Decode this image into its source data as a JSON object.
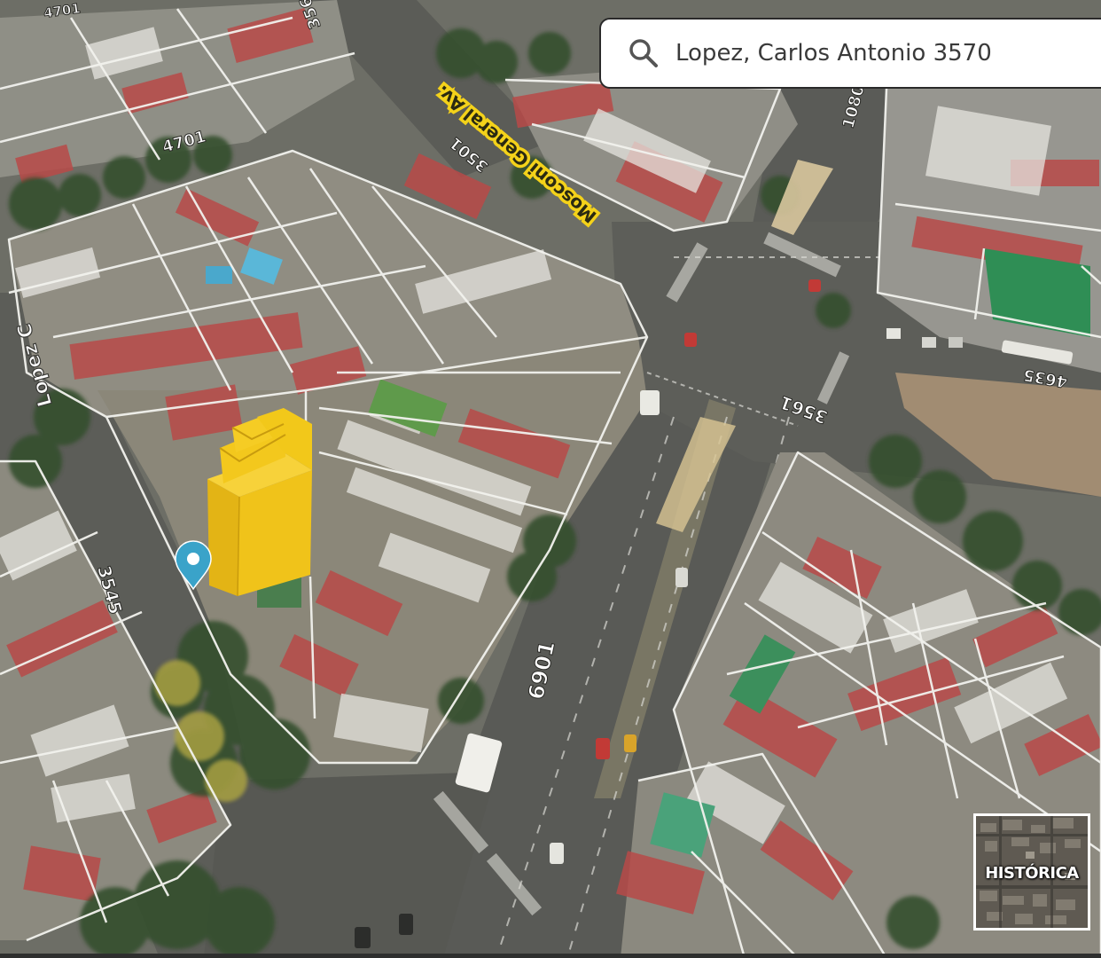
{
  "search": {
    "query": "Lopez, Carlos Antonio 3570",
    "icon": "search-icon"
  },
  "map": {
    "view": "3D aerial satellite",
    "street_labels": [
      {
        "text": "Mosconi General Av.",
        "kind": "street-name"
      },
      {
        "text": "Lopez C",
        "kind": "street-name"
      },
      {
        "text": "3561",
        "kind": "house-number"
      },
      {
        "text": "4701",
        "kind": "house-number"
      },
      {
        "text": "3501",
        "kind": "house-number"
      },
      {
        "text": "4701",
        "kind": "house-number"
      },
      {
        "text": "1080",
        "kind": "house-number"
      },
      {
        "text": "4635",
        "kind": "house-number"
      },
      {
        "text": "3561",
        "kind": "house-number"
      },
      {
        "text": "3545",
        "kind": "house-number"
      },
      {
        "text": "6901",
        "kind": "house-number"
      }
    ],
    "marker": {
      "icon": "location-pin-icon",
      "color": "#3aa3c9"
    },
    "highlight_color": "#f2c417",
    "label_highlight_color": "#f4d21a"
  },
  "historica": {
    "label": "HISTÓRICA"
  }
}
